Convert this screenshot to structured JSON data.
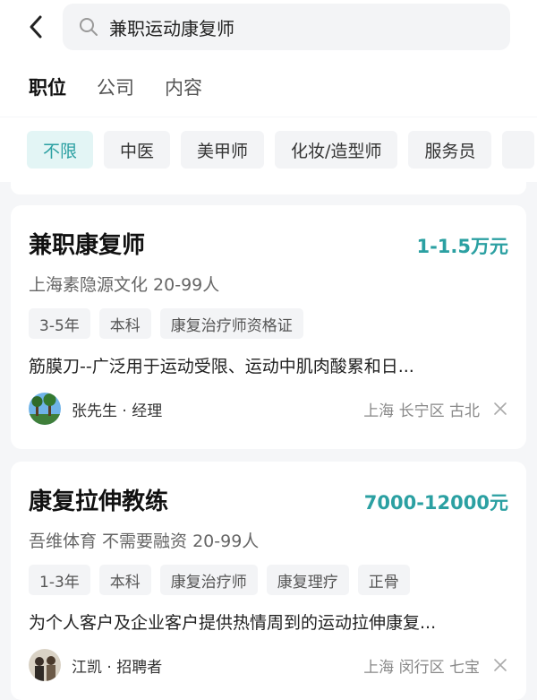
{
  "search": {
    "query": "兼职运动康复师"
  },
  "tabs": [
    {
      "label": "职位",
      "active": true
    },
    {
      "label": "公司",
      "active": false
    },
    {
      "label": "内容",
      "active": false
    }
  ],
  "filters": [
    "不限",
    "中医",
    "美甲师",
    "化妆/造型师",
    "服务员"
  ],
  "active_filter": "不限",
  "accent_color": "#2ba0a2",
  "jobs": [
    {
      "title": "兼职康复师",
      "salary": "1-1.5万元",
      "company": "上海素隐源文化 20-99人",
      "tags": [
        "3-5年",
        "本科",
        "康复治疗师资格证"
      ],
      "description": "筋膜刀--广泛用于运动受限、运动中肌肉酸累和日...",
      "recruiter": "张先生 · 经理",
      "location": "上海 长宁区 古北"
    },
    {
      "title": "康复拉伸教练",
      "salary": "7000-12000元",
      "company": "吾维体育 不需要融资 20-99人",
      "tags": [
        "1-3年",
        "本科",
        "康复治疗师",
        "康复理疗",
        "正骨"
      ],
      "description": "为个人客户及企业客户提供热情周到的运动拉伸康复...",
      "recruiter": "江凯 · 招聘者",
      "location": "上海 闵行区 七宝"
    }
  ]
}
